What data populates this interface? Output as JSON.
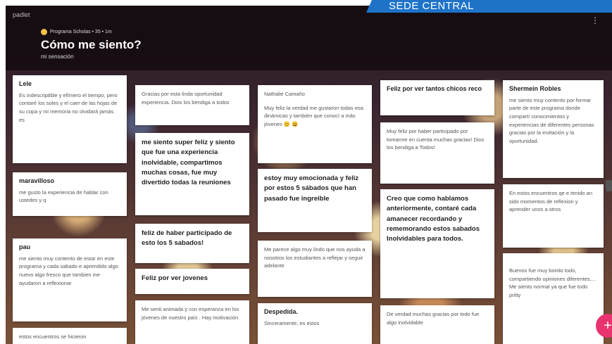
{
  "banner": {
    "label": "SEDE CENTRAL"
  },
  "header": {
    "app_name": "padlet",
    "author": "Programa Scholas • 35 • 1m",
    "title": "Cómo me siento?",
    "subtitle": "mi sensación",
    "menu_icon": "more-vert-icon"
  },
  "posts": [
    {
      "title": "Lele",
      "body": "Es indescriptible y efímero el tiempo, pero contaré los soles y el caer de las hojas de su copa y mi memoria no olvidará jamás es"
    },
    {
      "title": "maravilloso",
      "body": "me gusto la experiencia de hablar con ustedes y q"
    },
    {
      "title": "pau",
      "body": "me siento muy contento de estar en este programa y cada sabado e aprendido algo nuevo algo fresco que tambien me ayudaron a reflexionar"
    },
    {
      "title": "",
      "body": "estos encuentros se hicieron"
    },
    {
      "title": "",
      "body": "Gracias por esta linda oportunidad experiencia. Dios los bendiga a todos"
    },
    {
      "title": "",
      "big": "me siento super feliz y siento que fue una experiencia inolvidable, compartimos muchas cosas, fue muy divertido todas la reuniones"
    },
    {
      "title": "",
      "big": "feliz de haber participado de esto los 5 sabados!"
    },
    {
      "title": "",
      "big": "Feliz por ver jovenes"
    },
    {
      "title": "",
      "body": "Me senti animada y con esperanza en los jóvenes de nuestro país . Hay motivación"
    },
    {
      "title": "",
      "body": "Nathalie Camaño"
    },
    {
      "title": "",
      "body": "Muy feliz la verdad me gustaron todas esa dinámicas y también que conocí a más jóvenes 😊 😃"
    },
    {
      "title": "",
      "big": "estoy muy emocionada y feliz por estos 5 sábados que han pasado fue ingreible"
    },
    {
      "title": "",
      "body": "Me parece algo muy lindo que nos ayuda a nosotros los estudiantes a reflejar y seguir adelante"
    },
    {
      "title": "Despedida.",
      "body": "Sinceramente, es estos"
    },
    {
      "title": "Feliz por ver tantos chicos reco",
      "body": ""
    },
    {
      "title": "",
      "body": "Muy feliz por haber participado por tomarme en cuenta muchas gracias! Dios los bendiga a Todos!"
    },
    {
      "title": "",
      "big": "Creo que como hablamos anteriormente, contaré cada amanecer recordando y rememorando estos sabados Inolvidables para todos."
    },
    {
      "title": "",
      "body": "De verdad muchas gracias por todo fue algo inolvidable"
    },
    {
      "title": "Shermein Robles",
      "body": "me siento muy contento por formar parte de este programa donde compartí conocimientos y experiencias de diferentes personas gracias por la invitación y la oportunidad."
    },
    {
      "title": "",
      "body": "En estos encuentros qe e tenido an sido momentos de reflexion y aprender unos a otros"
    },
    {
      "title": "",
      "body": "Buenos fue muy bonito todo, compartiendo opiniones diferentes.... Me siento normal ya que fue todo pritty"
    }
  ],
  "fab": {
    "label": "+"
  }
}
